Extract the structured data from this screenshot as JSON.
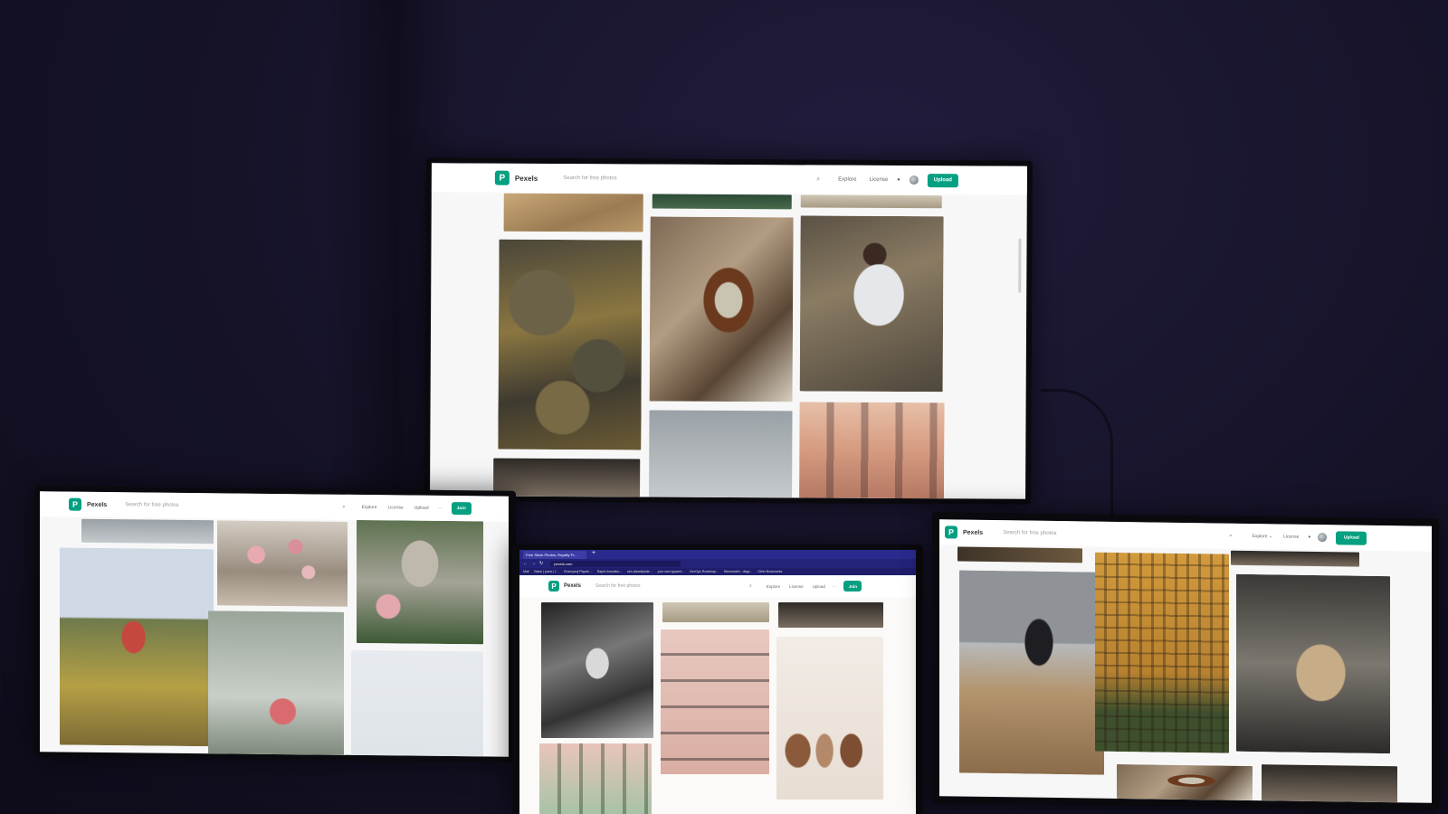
{
  "scene": "four-monitors-showing-pexels",
  "center_monitor": {
    "brand": "Pexels",
    "logo_letter": "P",
    "search_placeholder": "Search for free photos",
    "nav": [
      "Explore",
      "License"
    ],
    "upload_label": "Upload",
    "icons": [
      "search-icon",
      "bell-icon",
      "avatar"
    ]
  },
  "left_monitor": {
    "brand": "Pexels",
    "logo_letter": "P",
    "search_placeholder": "Search for free photos",
    "nav": [
      "Explore",
      "License",
      "Upload"
    ],
    "more_label": "···",
    "join_label": "Join"
  },
  "middle_laptop": {
    "tab_title": "Free Stock Photos, Royalty Fr...",
    "url": "pexels.com",
    "bookmarks": [
      "Mail",
      "Black | yume | f...",
      "Rozmyacji Piąsek...",
      "Rapid Innovator...",
      "sex-classifyside...",
      "your-wex-typsent...",
      "DevOps Roadmap...",
      "Newmarket - diagr...",
      "Other Bookmarks"
    ],
    "brand": "Pexels",
    "logo_letter": "P",
    "search_placeholder": "Search for free photos",
    "nav": [
      "Explore",
      "License",
      "Upload"
    ],
    "more_label": "···",
    "join_label": "Join"
  },
  "right_laptop": {
    "brand": "Pexels",
    "logo_letter": "P",
    "search_placeholder": "Search for free photos",
    "nav": [
      "Explore ⌄",
      "License"
    ],
    "upload_label": "Upload"
  },
  "colors": {
    "pexels_green": "#05a081",
    "room_background": "#17142b"
  }
}
